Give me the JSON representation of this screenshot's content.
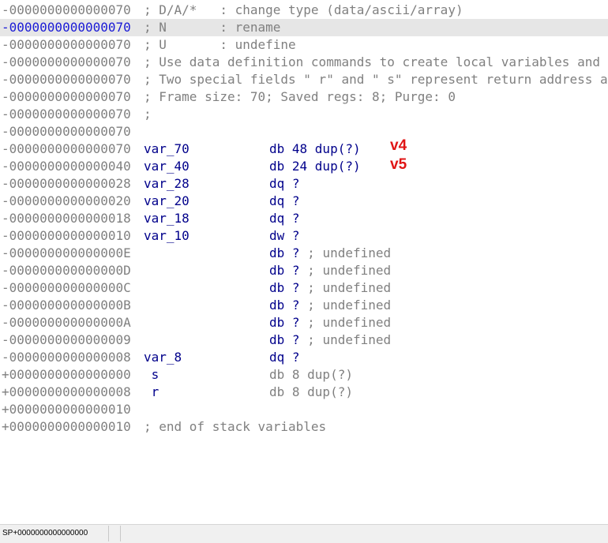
{
  "lines": [
    {
      "addr": "-0000000000000070",
      "comment": "; D/A/*   : change type (data/ascii/array)"
    },
    {
      "addr": "-0000000000000070",
      "comment": "; N       : rename",
      "highlighted": true
    },
    {
      "addr": "-0000000000000070",
      "comment": "; U       : undefine"
    },
    {
      "addr": "-0000000000000070",
      "comment": "; Use data definition commands to create local variables and function arguments."
    },
    {
      "addr": "-0000000000000070",
      "comment": "; Two special fields \" r\" and \" s\" represent return address and saved registers."
    },
    {
      "addr": "-0000000000000070",
      "comment": "; Frame size: 70; Saved regs: 8; Purge: 0"
    },
    {
      "addr": "-0000000000000070",
      "comment": ";"
    },
    {
      "addr": "-0000000000000070",
      "comment": ""
    },
    {
      "addr": "-0000000000000070",
      "var": "var_70",
      "def": "db 48 dup(?)"
    },
    {
      "addr": "-0000000000000040",
      "var": "var_40",
      "def": "db 24 dup(?)"
    },
    {
      "addr": "-0000000000000028",
      "var": "var_28",
      "def": "dq ?"
    },
    {
      "addr": "-0000000000000020",
      "var": "var_20",
      "def": "dq ?"
    },
    {
      "addr": "-0000000000000018",
      "var": "var_18",
      "def": "dq ?"
    },
    {
      "addr": "-0000000000000010",
      "var": "var_10",
      "def": "dw ?"
    },
    {
      "addr": "-000000000000000E",
      "var": "",
      "def": "db ?",
      "note": "; undefined"
    },
    {
      "addr": "-000000000000000D",
      "var": "",
      "def": "db ?",
      "note": "; undefined"
    },
    {
      "addr": "-000000000000000C",
      "var": "",
      "def": "db ?",
      "note": "; undefined"
    },
    {
      "addr": "-000000000000000B",
      "var": "",
      "def": "db ?",
      "note": "; undefined"
    },
    {
      "addr": "-000000000000000A",
      "var": "",
      "def": "db ?",
      "note": "; undefined"
    },
    {
      "addr": "-0000000000000009",
      "var": "",
      "def": "db ?",
      "note": "; undefined"
    },
    {
      "addr": "-0000000000000008",
      "var": "var_8",
      "def": "dq ?"
    },
    {
      "addr": "+0000000000000000",
      "var": " s",
      "def": "db 8 dup(?)",
      "special": true
    },
    {
      "addr": "+0000000000000008",
      "var": " r",
      "def": "db 8 dup(?)",
      "special": true
    },
    {
      "addr": "+0000000000000010",
      "comment": ""
    },
    {
      "addr": "+0000000000000010",
      "comment": "; end of stack variables"
    }
  ],
  "annotations": {
    "v4": "v4",
    "v5": "v5"
  },
  "statusbar": {
    "sp": "SP+0000000000000000"
  },
  "colors": {
    "address": "#808080",
    "highlight_address": "#1a1ad6",
    "highlight_row": "#e6e6e6",
    "variable": "#00008b",
    "annotation": "#e01515"
  }
}
